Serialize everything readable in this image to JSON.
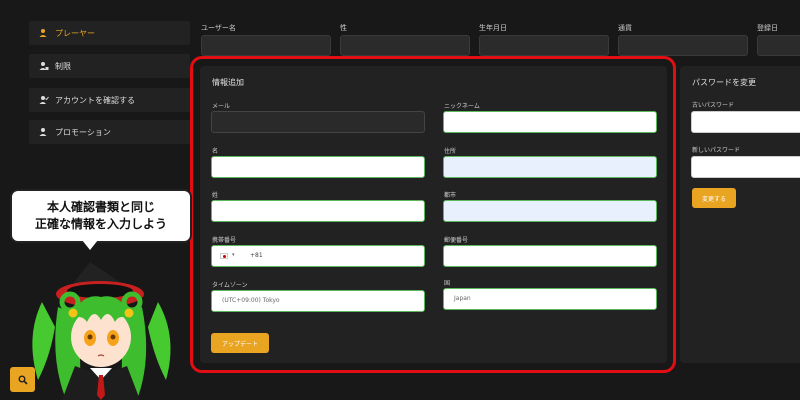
{
  "sidebar": {
    "items": [
      {
        "label": "プレーヤー",
        "icon": "user-icon"
      },
      {
        "label": "制限",
        "icon": "user-lock-icon"
      },
      {
        "label": "アカウントを確認する",
        "icon": "user-check-icon"
      },
      {
        "label": "プロモーション",
        "icon": "user-icon"
      }
    ]
  },
  "top_fields": {
    "labels": [
      "ユーザー名",
      "性",
      "生年月日",
      "通貨",
      "登録日"
    ]
  },
  "info_card": {
    "title": "情報追加",
    "labels": {
      "email": "メール",
      "nickname": "ニックネーム",
      "first_name": "名",
      "address": "住所",
      "last_name": "姓",
      "city": "都市",
      "phone": "携帯番号",
      "postal": "郵便番号",
      "timezone": "タイムゾーン",
      "country": "国"
    },
    "values": {
      "phone_prefix": "+81",
      "timezone": "(UTC+09:00) Tokyo",
      "country": "Japan"
    },
    "update_button": "アップデート"
  },
  "password_card": {
    "title": "パスワードを変更",
    "old_label": "古いパスワード",
    "new_label": "新しいパスワード",
    "change_button": "変更する"
  },
  "callout": {
    "line1": "本人確認書類と同じ",
    "line2": "正確な情報を入力しよう"
  },
  "colors": {
    "accent": "#e9a422",
    "highlight": "#e10f14",
    "field_border": "#5cb85c"
  }
}
